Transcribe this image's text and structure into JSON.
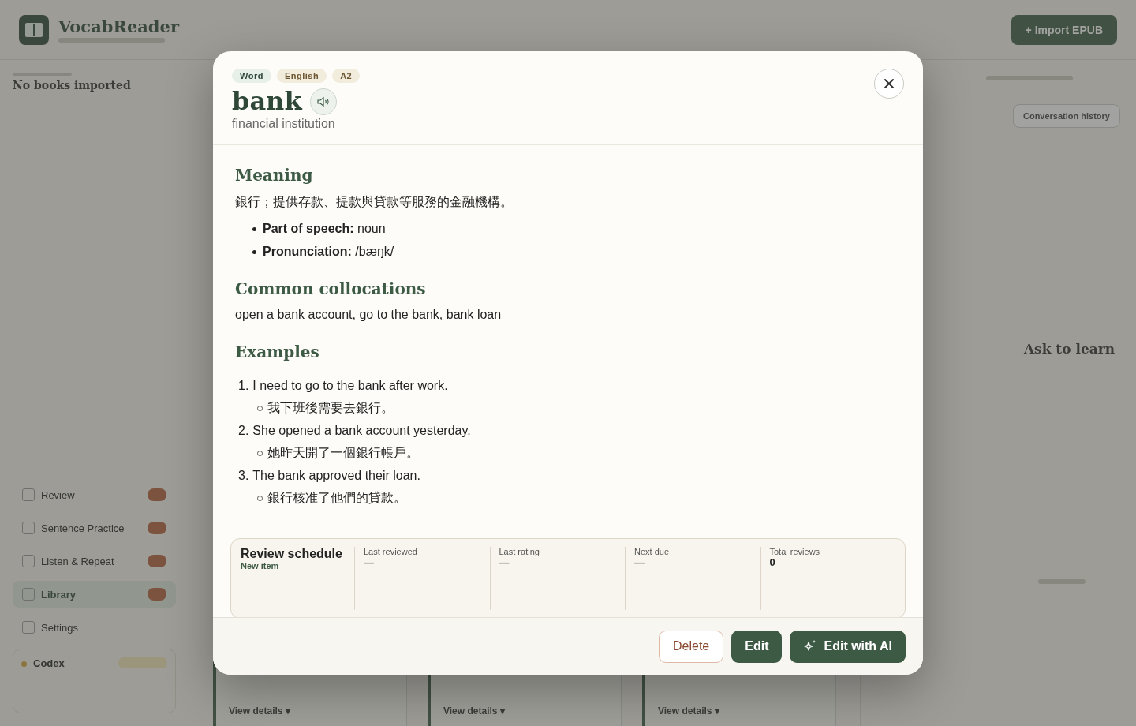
{
  "app": {
    "title": "VocabReader",
    "import_button": "+ Import EPUB"
  },
  "sidebar": {
    "status": "No books imported",
    "items": [
      {
        "label": "Review",
        "badge": true,
        "selected": false
      },
      {
        "label": "Sentence Practice",
        "badge": true,
        "selected": false
      },
      {
        "label": "Listen & Repeat",
        "badge": true,
        "selected": false
      },
      {
        "label": "Library",
        "badge": true,
        "selected": true
      },
      {
        "label": "Settings",
        "badge": false,
        "selected": false
      }
    ],
    "codex": {
      "title": "Codex"
    }
  },
  "main": {
    "cards": [
      {
        "link": "View details ▾"
      },
      {
        "link": "View details ▾"
      },
      {
        "link": "View details ▾"
      }
    ]
  },
  "chat_panel": {
    "history_button": "Conversation history",
    "empty_title": "Ask to learn"
  },
  "dialog": {
    "tags": [
      {
        "label": "Word",
        "kind": "type"
      },
      {
        "label": "English",
        "kind": "meta"
      },
      {
        "label": "A2",
        "kind": "meta"
      }
    ],
    "word": "bank",
    "gloss": "financial institution",
    "sections": [
      {
        "kind": "paragraph",
        "heading": "Meaning",
        "text": "銀行；提供存款、提款與貸款等服務的金融機構。",
        "bullets": [
          "**Part of speech:** noun",
          "**Pronunciation:** /bæŋk/"
        ]
      },
      {
        "kind": "paragraph",
        "heading": "Common collocations",
        "text": "open a bank account, go to the bank, bank loan"
      },
      {
        "kind": "examples",
        "heading": "Examples",
        "examples": [
          {
            "number": "1.",
            "text": "I need to go to the bank after work.",
            "translation": "我下班後需要去銀行。"
          },
          {
            "number": "2.",
            "text": "She opened a bank account yesterday.",
            "translation": "她昨天開了一個銀行帳戶。"
          },
          {
            "number": "3.",
            "text": "The bank approved their loan.",
            "translation": "銀行核准了他們的貸款。"
          }
        ]
      }
    ],
    "review": {
      "title": "Review schedule",
      "status": "New item",
      "fields": [
        {
          "label": "Last reviewed",
          "value": "—"
        },
        {
          "label": "Last rating",
          "value": "—"
        },
        {
          "label": "Next due",
          "value": "—"
        },
        {
          "label": "Total reviews",
          "value": "0"
        }
      ]
    },
    "buttons": [
      {
        "label": "Delete",
        "kind": "danger"
      },
      {
        "label": "Edit",
        "kind": "primary"
      },
      {
        "label": "Edit with AI",
        "kind": "ai"
      }
    ]
  }
}
